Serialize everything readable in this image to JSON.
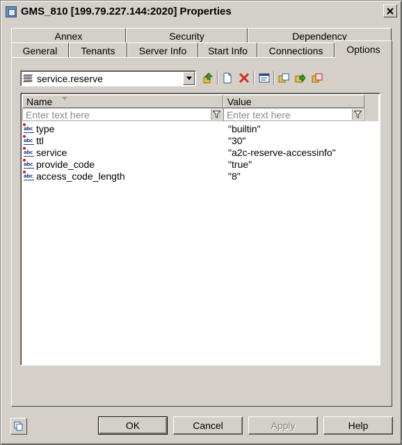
{
  "window": {
    "title": "GMS_810 [199.79.227.144:2020] Properties",
    "close_label": "X"
  },
  "tabs": {
    "row1": [
      "Annex",
      "Security",
      "Dependency"
    ],
    "row2": [
      "General",
      "Tenants",
      "Server Info",
      "Start Info",
      "Connections",
      "Options"
    ],
    "active": "Options"
  },
  "toolbar": {
    "section_selected": "service.reserve",
    "icons": [
      "move-up-icon",
      "new-icon",
      "delete-icon",
      "edit-icon",
      "copy-icon",
      "import-icon",
      "export-icon"
    ]
  },
  "grid": {
    "columns": [
      "Name",
      "Value"
    ],
    "filter_placeholder": "Enter text here",
    "rows": [
      {
        "name": "type",
        "value": "\"builtin\""
      },
      {
        "name": "ttl",
        "value": "\"30\""
      },
      {
        "name": "service",
        "value": "\"a2c-reserve-accessinfo\""
      },
      {
        "name": "provide_code",
        "value": "\"true\""
      },
      {
        "name": "access_code_length",
        "value": "\"8\""
      }
    ]
  },
  "buttons": {
    "ok": "OK",
    "cancel": "Cancel",
    "apply": "Apply",
    "help": "Help"
  },
  "colors": {
    "dialog_bg": "#d4d0c8",
    "delete_icon": "#d42a1a",
    "accent_icon": "#e2a11a"
  }
}
